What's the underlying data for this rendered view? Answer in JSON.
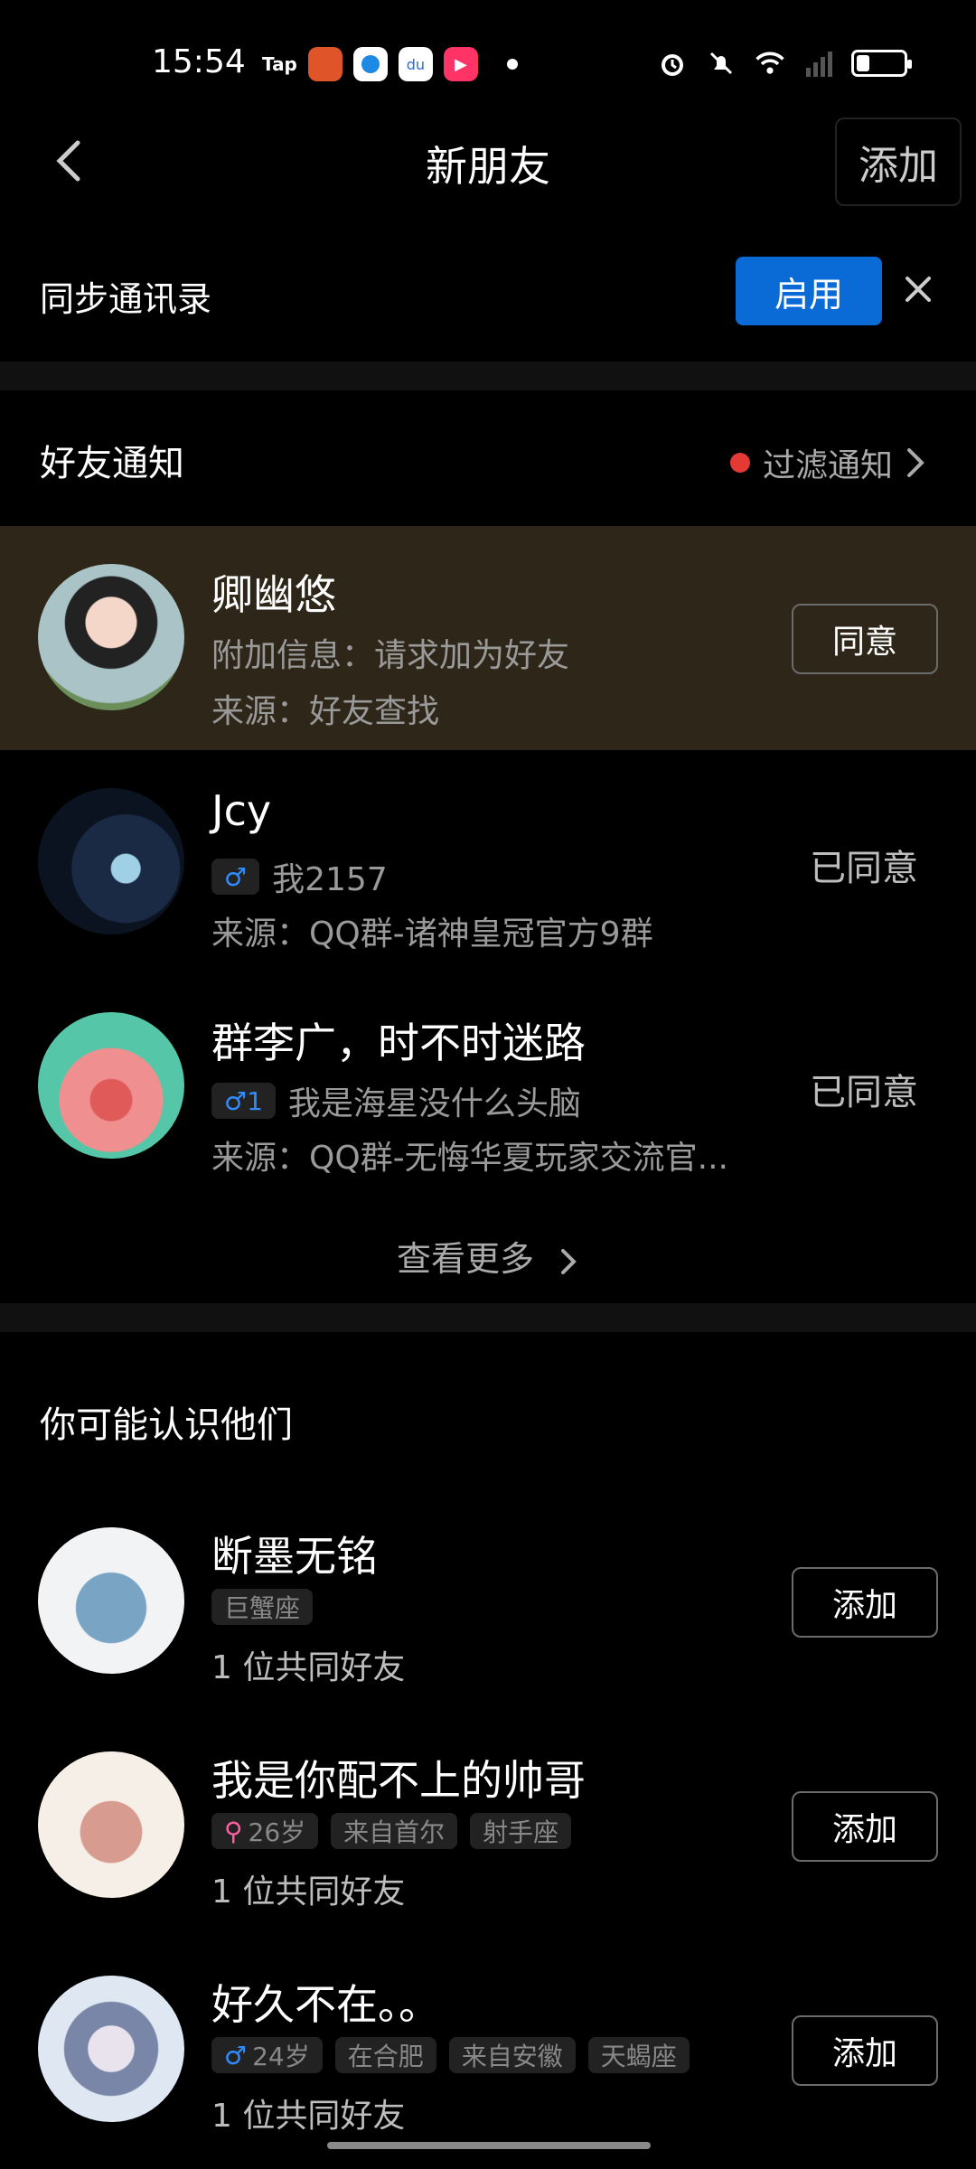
{
  "status_bar": {
    "time": "15:54",
    "apps": [
      "Tap",
      "store",
      "browser",
      "baidu",
      "video"
    ]
  },
  "header": {
    "title": "新朋友",
    "add_label": "添加"
  },
  "sync": {
    "label": "同步通讯录",
    "enable_label": "启用"
  },
  "notifications": {
    "title": "好友通知",
    "filter_label": "过滤通知",
    "items": [
      {
        "name": "卿幽悠",
        "line1": "附加信息：请求加为好友",
        "line2": "来源：好友查找",
        "action": "同意"
      },
      {
        "name": "Jcy",
        "badge": "♂",
        "line1": "我2157",
        "line2": "来源：QQ群-诸神皇冠官方9群",
        "action": "已同意"
      },
      {
        "name": "群李广，时不时迷路",
        "badge": "♂1",
        "line1": "我是海星没什么头脑",
        "line2": "来源：QQ群-无悔华夏玩家交流官...",
        "action": "已同意"
      }
    ],
    "more_label": "查看更多"
  },
  "suggestions": {
    "title": "你可能认识他们",
    "items": [
      {
        "name": "断墨无铭",
        "tags": [
          "巨蟹座"
        ],
        "mutual": "1 位共同好友",
        "action": "添加"
      },
      {
        "name": "我是你配不上的帅哥",
        "tags": [
          "26岁",
          "来自首尔",
          "射手座"
        ],
        "mutual": "1 位共同好友",
        "action": "添加"
      },
      {
        "name": "好久不在。。",
        "tags": [
          "24岁",
          "在合肥",
          "来自安徽",
          "天蝎座"
        ],
        "mutual": "1 位共同好友",
        "action": "添加"
      }
    ]
  }
}
